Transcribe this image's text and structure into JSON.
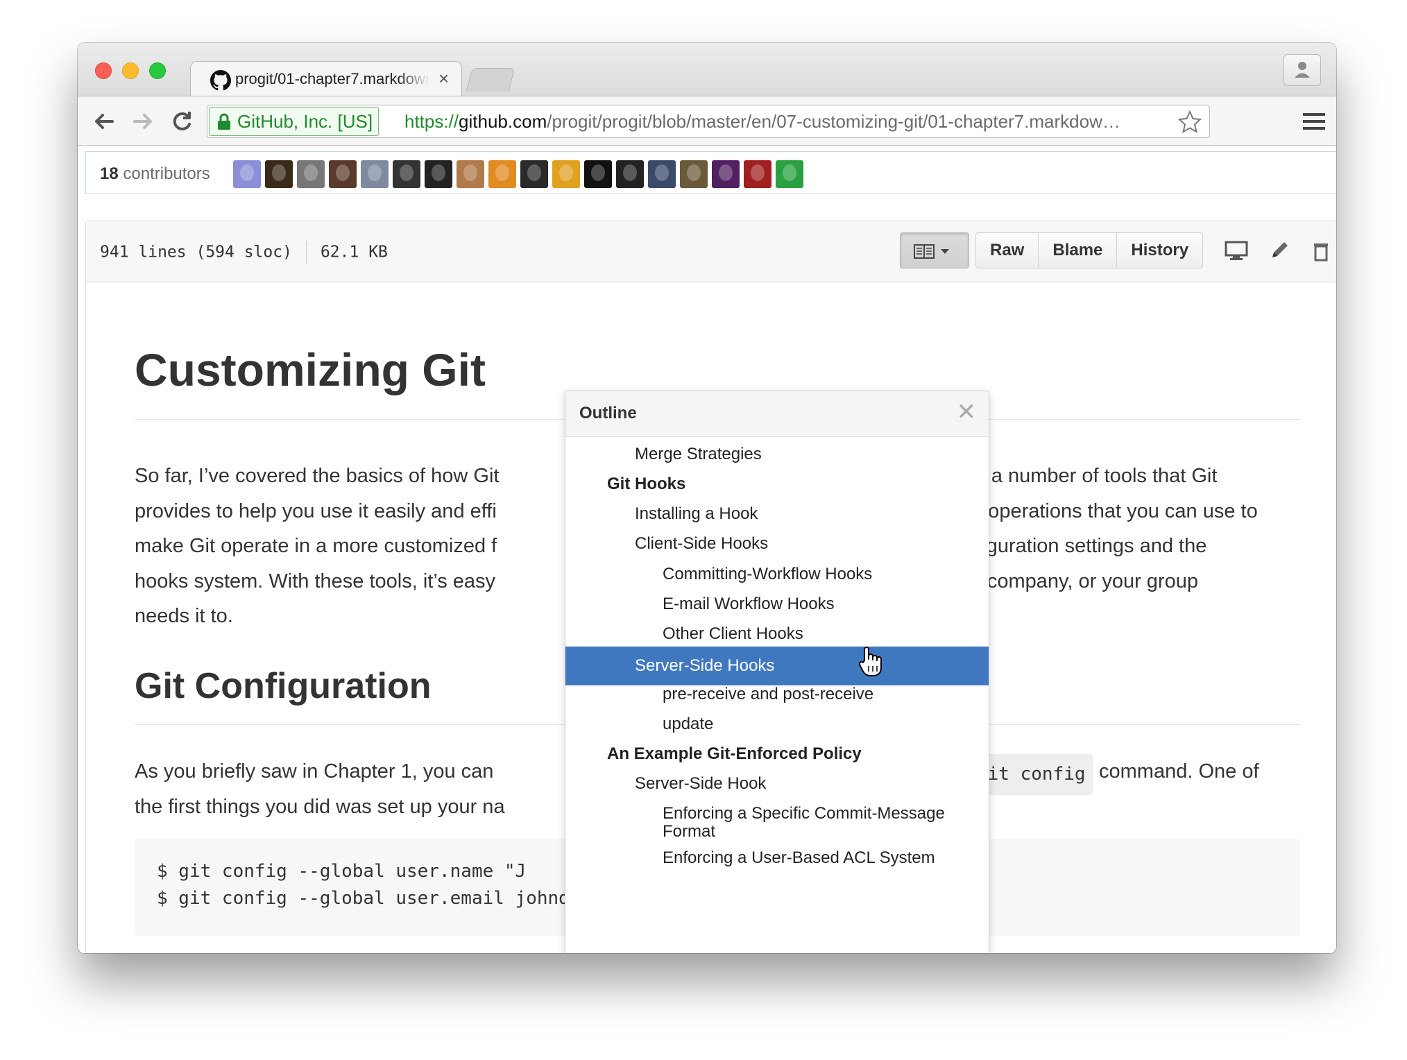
{
  "browser": {
    "tab_title": "progit/01-chapter7.markdown",
    "tab_close": "×",
    "ev_label": "GitHub, Inc. [US]",
    "url_proto": "https://",
    "url_host": "github.com",
    "url_path": "/progit/progit/blob/master/en/07-customizing-git/01-chapter7.markdow…"
  },
  "contributors": {
    "count": "18",
    "label": "contributors",
    "avatar_colors": [
      "#8a8fd6",
      "#3a2a1a",
      "#777",
      "#5a3a2a",
      "#7f8aa0",
      "#333",
      "#222",
      "#b07a4a",
      "#e08a20",
      "#2a2a2a",
      "#e0a020",
      "#111",
      "#222",
      "#3a4a6a",
      "#6a5a3a",
      "#502060",
      "#a02020",
      "#2aa040"
    ]
  },
  "file": {
    "lines": "941 lines (594 sloc)",
    "size": "62.1 KB",
    "raw": "Raw",
    "blame": "Blame",
    "history": "History"
  },
  "doc": {
    "h1": "Customizing Git",
    "p1_line1_a": "So far, I’ve covered the basics of how Git",
    "p1_line1_b": "ced a number of tools that Git",
    "p1_line2_a": "provides to help you use it easily and effi",
    "p1_line2_b": "e operations that you can use to",
    "p1_line3_a": "make Git operate in a more customized f",
    "p1_line3_b": "onfiguration settings and the",
    "p1_line4_a": "hooks system. With these tools, it’s easy",
    "p1_line4_b": "ur company, or your group",
    "p1_line5": "needs it to.",
    "h2": "Git Configuration",
    "p2_line1_a": "As you briefly saw in Chapter 1, you can",
    "p2_line1_code": "git config",
    "p2_line1_b": "command. One of",
    "p2_line2_a": "the first things you did was set up your na",
    "code_line1": "$ git config --global user.name \"J",
    "code_line2": "$ git config --global user.email johndoe@example.com"
  },
  "outline": {
    "title": "Outline",
    "close": "✕",
    "items": [
      {
        "label": "Merge Strategies",
        "level": 3
      },
      {
        "label": "Git Hooks",
        "level": 2
      },
      {
        "label": "Installing a Hook",
        "level": 3
      },
      {
        "label": "Client-Side Hooks",
        "level": 3
      },
      {
        "label": "Committing-Workflow Hooks",
        "level": 4
      },
      {
        "label": "E-mail Workflow Hooks",
        "level": 4
      },
      {
        "label": "Other Client Hooks",
        "level": 4
      },
      {
        "label": "Server-Side Hooks",
        "level": 3,
        "selected": true
      },
      {
        "label": "pre-receive and post-receive",
        "level": 4
      },
      {
        "label": "update",
        "level": 4
      },
      {
        "label": "An Example Git-Enforced Policy",
        "level": 2
      },
      {
        "label": "Server-Side Hook",
        "level": 3
      },
      {
        "label": "Enforcing a Specific Commit-Message Format",
        "level": 4
      },
      {
        "label": "Enforcing a User-Based ACL System",
        "level": 4
      }
    ]
  },
  "colors": {
    "selection": "#4078c0",
    "ev_green": "#1f8a2e"
  }
}
